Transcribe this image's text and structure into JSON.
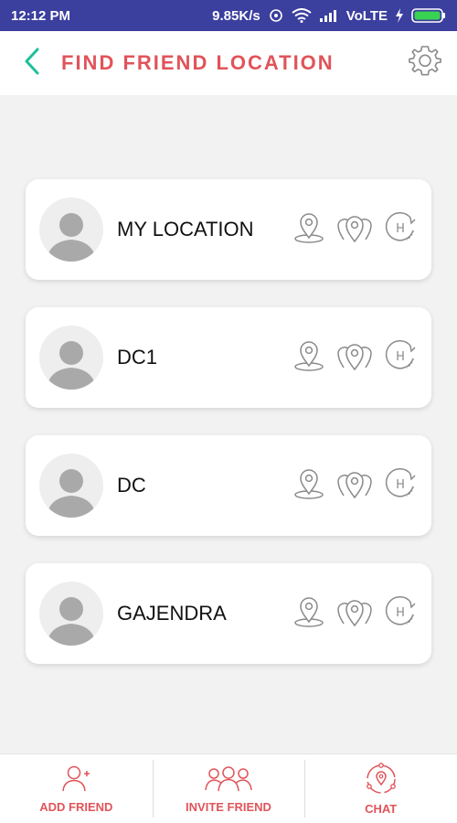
{
  "status_bar": {
    "time": "12:12 PM",
    "speed": "9.85K/s",
    "network": "VoLTE"
  },
  "header": {
    "title": "FIND FRIEND LOCATION"
  },
  "friends": [
    {
      "name": "MY LOCATION"
    },
    {
      "name": "DC1"
    },
    {
      "name": "DC"
    },
    {
      "name": "GAJENDRA"
    }
  ],
  "bottom_nav": {
    "add_friend": "ADD FRIEND",
    "invite_friend": "INVITE FRIEND",
    "chat": "CHAT"
  },
  "colors": {
    "status_bar": "#3b3f9e",
    "accent": "#e0545a",
    "back_arrow": "#1fbf9a",
    "icon_gray": "#8a8a8a"
  }
}
